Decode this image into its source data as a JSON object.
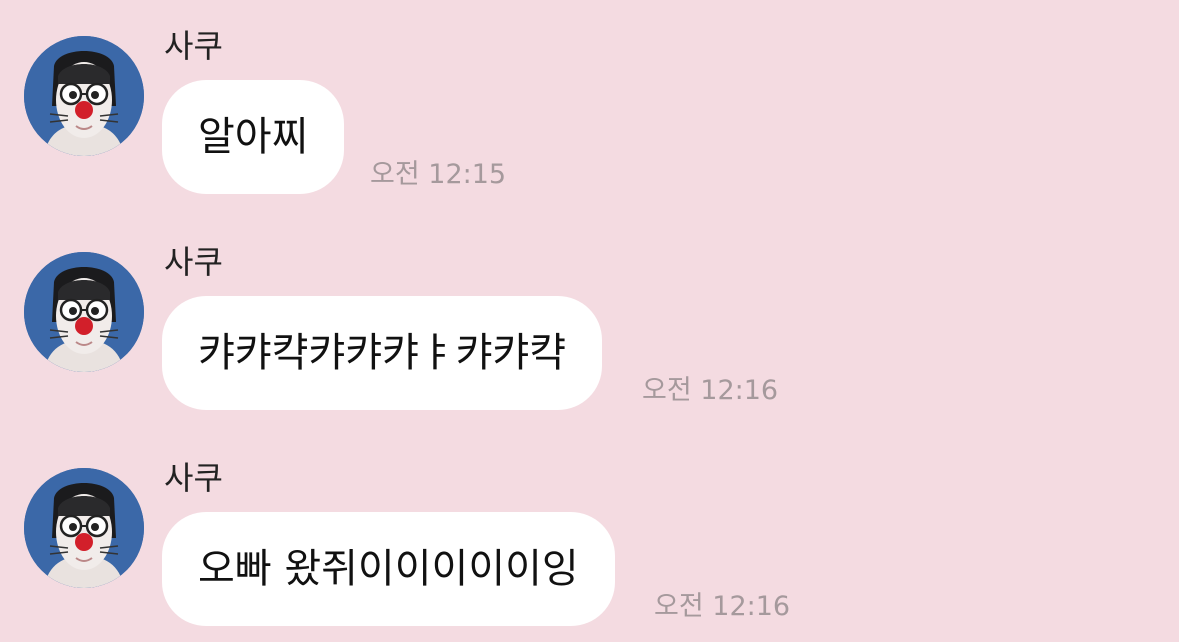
{
  "messages": [
    {
      "sender": "사쿠",
      "text": "알아찌",
      "time": "오전 12:15"
    },
    {
      "sender": "사쿠",
      "text": "캬캬캭캬캬캬ㅑ캬캬캭",
      "time": "오전 12:16"
    },
    {
      "sender": "사쿠",
      "text": "오빠 왔쥐이이이이이잉",
      "time": "오전 12:16"
    }
  ],
  "colors": {
    "background": "#f4dbe1",
    "bubble": "#ffffff",
    "timestamp": "#a5999c",
    "avatar_background": "#3b68a8",
    "avatar_nose": "#d21f2a"
  }
}
